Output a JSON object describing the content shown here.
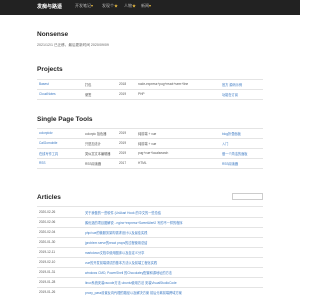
{
  "header": {
    "brand": "发痴与路遥",
    "nav": [
      {
        "label": "开发笔记",
        "glyph": "▾"
      },
      {
        "label": "发现个",
        "glyph": "★"
      },
      {
        "label": "人物",
        "glyph": "★"
      },
      {
        "label": "新闻",
        "glyph": "▾"
      }
    ]
  },
  "intro": {
    "title": "Nonsense",
    "subtitle": "2021/12/1 已迁移。最后更新时间 2020/09/09"
  },
  "projects": {
    "title": "Projects",
    "rows": [
      {
        "name": "Basest",
        "lang": "打包",
        "year": "2018",
        "desc": "node-express+pug+react+sem+line",
        "link": "官方 源码示例"
      },
      {
        "name": "CloudNotes",
        "lang": "便签",
        "year": "2019",
        "desc": "PHP",
        "link": "功能在订阅"
      }
    ]
  },
  "spa": {
    "title": "Single Page Tools",
    "rows": [
      {
        "name": "colorpickr",
        "lang": "colorpic 拾色器",
        "year": "2019",
        "desc": "纯前端 + vue",
        "link": "blog折叠面板"
      },
      {
        "name": "CalGomobile",
        "lang": "只是加法计",
        "year": "2019",
        "desc": "纯前端 + vue",
        "link": "入门"
      },
      {
        "name": "在线写作工具",
        "lang": "类似富文本编辑器",
        "year": "2019",
        "desc": "pug+vue+localsearch",
        "link": "做一个简洁的面板"
      },
      {
        "name": "RSS",
        "lang": "RSS阅读器",
        "year": "2017",
        "desc": "HTML",
        "link": "RSS阅读器"
      }
    ]
  },
  "articles": {
    "title": "Articles",
    "search_placeholder": "",
    "rows": [
      {
        "date": "2020-02-26",
        "title": "关于我做的一些软件 (UrAkari Hook 的中文的一些总结"
      },
      {
        "date": "2020-02-06",
        "title": "鹅优选的项目图解说 - nginx+express+SweetAlert2 写的不一样的程序"
      },
      {
        "date": "2020-02-04",
        "title": "php/vue的微服务架构需求设计以及最佳实践"
      },
      {
        "date": "2020-01-30",
        "title": "jproblem serve的react props的过程使用总结"
      },
      {
        "date": "2019-12-11",
        "title": "markdown文档中使用图床以及自定义分享"
      },
      {
        "date": "2019-02-10",
        "title": "vue的开发前端调试的基本方法以及前端工程化实践"
      },
      {
        "date": "2019-01-31",
        "title": "windows CMD, PowerShell 的Chocolatey配置和源地址的方法"
      },
      {
        "date": "2019-01-28",
        "title": "linux系统安装vscode方法 ubuntu使用方法 安装VisualStudioCode"
      },
      {
        "date": "2019-01-26",
        "title": "proxy_pass设置反向代理的路径以及解决方案 前后分离前端跨域方案"
      }
    ]
  }
}
